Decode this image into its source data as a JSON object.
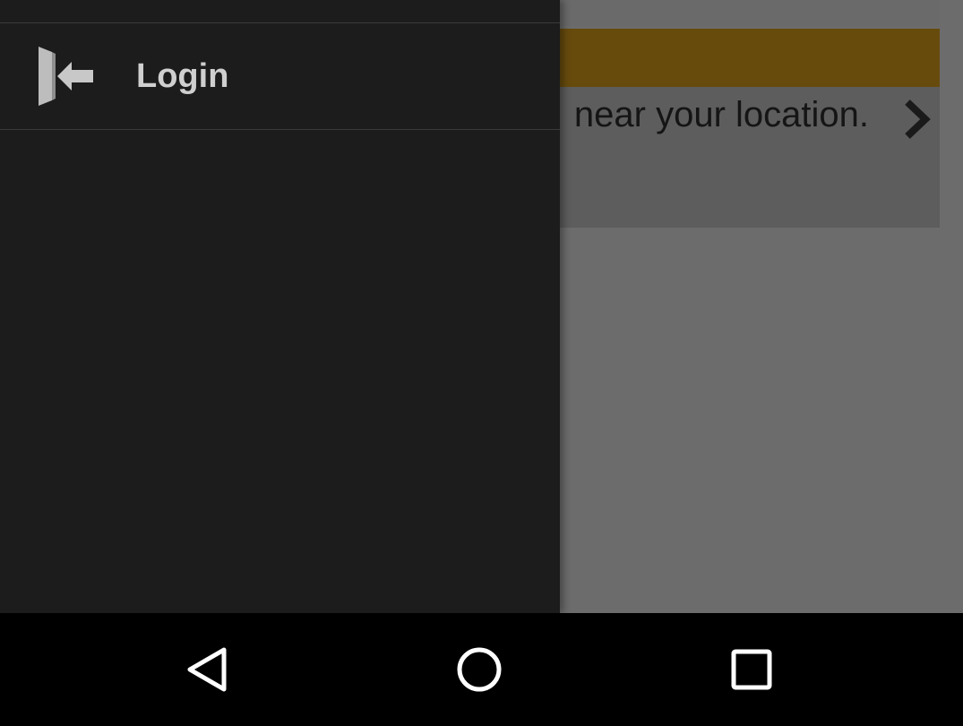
{
  "background_app": {
    "card_text": "near your location.",
    "chevron_icon": "chevron-right-icon",
    "banner_color": "#674b0d"
  },
  "drawer": {
    "items": [
      {
        "label": "Login",
        "icon": "login-icon"
      }
    ]
  },
  "navbar": {
    "back_icon": "back-triangle-icon",
    "home_icon": "home-circle-icon",
    "recents_icon": "recents-square-icon"
  }
}
